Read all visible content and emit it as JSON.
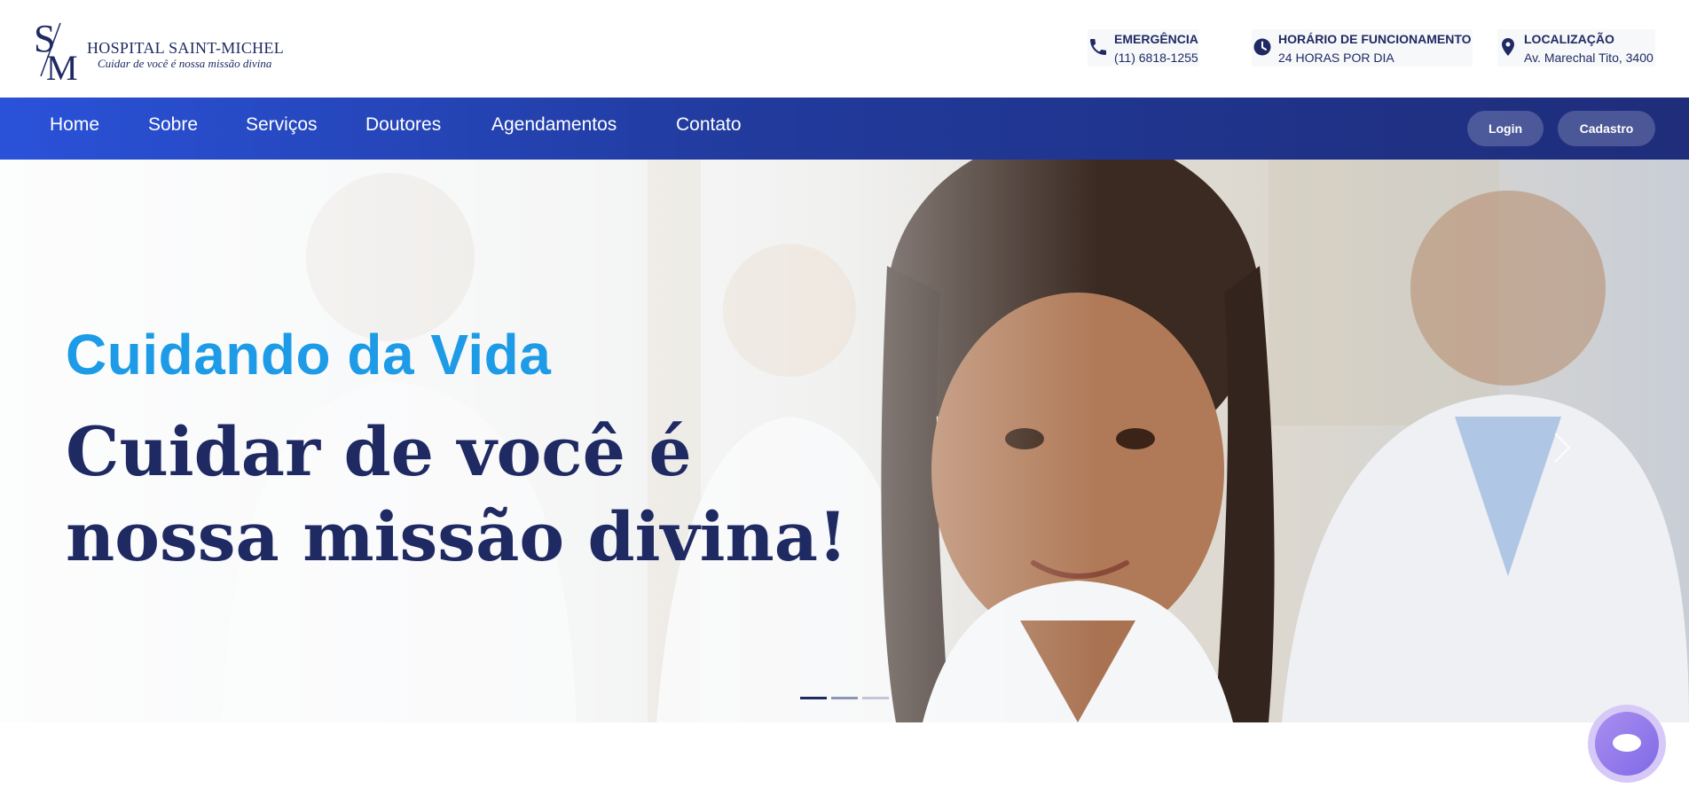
{
  "brand": {
    "monogram_s": "S",
    "monogram_m": "M",
    "name": "HOSPITAL SAINT-MICHEL",
    "tagline": "Cuidar de você é nossa missão divina"
  },
  "contact_info": [
    {
      "icon": "phone-icon",
      "title": "EMERGÊNCIA",
      "value": "(11) 6818-1255"
    },
    {
      "icon": "clock-icon",
      "title": "HORÁRIO DE FUNCIONAMENTO",
      "value": "24 HORAS POR DIA"
    },
    {
      "icon": "location-pin-icon",
      "title": "LOCALIZAÇÃO",
      "value": "Av. Marechal Tito, 3400"
    }
  ],
  "nav": {
    "items": [
      "Home",
      "Sobre",
      "Serviços",
      "Doutores",
      "Agendamentos",
      "Contato"
    ],
    "login_label": "Login",
    "signup_label": "Cadastro"
  },
  "hero": {
    "subtitle": "Cuidando da Vida",
    "title": "Cuidar de você é nossa missão divina!",
    "slides_total": 3,
    "active_slide": 1
  },
  "colors": {
    "navy": "#1f2a63",
    "accent_blue": "#1d9be6",
    "nav_gradient_start": "#2a52d9",
    "nav_gradient_end": "#1f2d7a",
    "chat_purple": "#8c74ea"
  }
}
